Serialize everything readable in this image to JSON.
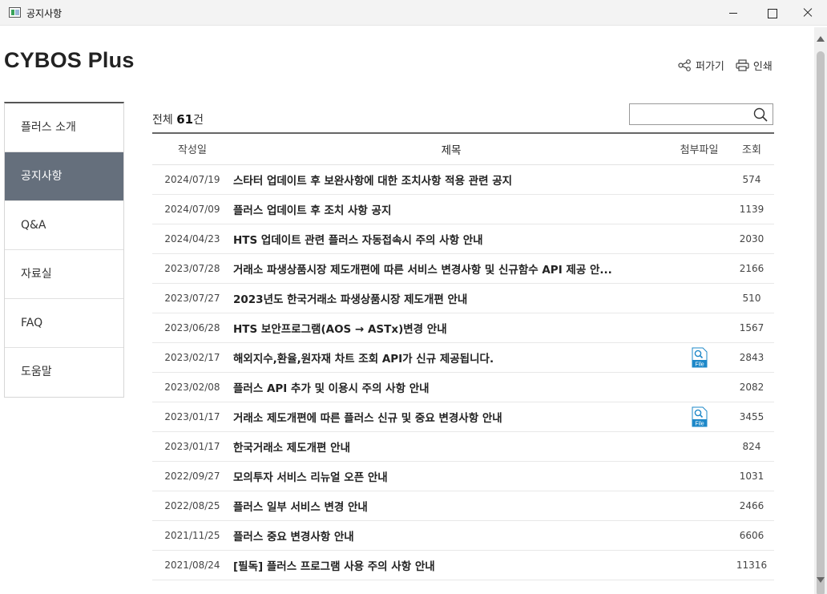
{
  "window": {
    "title": "공지사항"
  },
  "brand": "CYBOS Plus",
  "actions": {
    "share": "퍼가기",
    "print": "인쇄"
  },
  "sidebar": {
    "items": [
      {
        "label": "플러스 소개",
        "active": false
      },
      {
        "label": "공지사항",
        "active": true
      },
      {
        "label": "Q&A",
        "active": false
      },
      {
        "label": "자료실",
        "active": false
      },
      {
        "label": "FAQ",
        "active": false
      },
      {
        "label": "도움말",
        "active": false
      }
    ]
  },
  "board": {
    "total_prefix": "전체",
    "total_count": "61",
    "total_suffix": "건",
    "search": {
      "value": "",
      "placeholder": ""
    },
    "headers": {
      "date": "작성일",
      "title": "제목",
      "file": "첨부파일",
      "views": "조회"
    },
    "rows": [
      {
        "date": "2024/07/19",
        "title": "스타터 업데이트 후 보완사항에 대한 조치사항 적용 관련 공지",
        "file": false,
        "views": "574"
      },
      {
        "date": "2024/07/09",
        "title": "플러스 업데이트 후 조치 사항 공지",
        "file": false,
        "views": "1139"
      },
      {
        "date": "2024/04/23",
        "title": "HTS 업데이트 관련 플러스 자동접속시 주의 사항 안내",
        "file": false,
        "views": "2030"
      },
      {
        "date": "2023/07/28",
        "title": "거래소 파생상품시장 제도개편에 따른 서비스 변경사항 및 신규함수 API 제공 안...",
        "file": false,
        "views": "2166"
      },
      {
        "date": "2023/07/27",
        "title": "2023년도 한국거래소 파생상품시장 제도개편 안내",
        "file": false,
        "views": "510"
      },
      {
        "date": "2023/06/28",
        "title": "HTS 보안프로그램(AOS → ASTx)변경 안내",
        "file": false,
        "views": "1567"
      },
      {
        "date": "2023/02/17",
        "title": "해외지수,환율,원자재 차트 조회 API가 신규 제공됩니다.",
        "file": true,
        "views": "2843"
      },
      {
        "date": "2023/02/08",
        "title": "플러스 API 추가 및 이용시 주의 사항 안내",
        "file": false,
        "views": "2082"
      },
      {
        "date": "2023/01/17",
        "title": "거래소 제도개편에 따른 플러스 신규 및 중요 변경사항 안내",
        "file": true,
        "views": "3455"
      },
      {
        "date": "2023/01/17",
        "title": "한국거래소 제도개편 안내",
        "file": false,
        "views": "824"
      },
      {
        "date": "2022/09/27",
        "title": "모의투자 서비스 리뉴얼 오픈 안내",
        "file": false,
        "views": "1031"
      },
      {
        "date": "2022/08/25",
        "title": "플러스 일부 서비스 변경 안내",
        "file": false,
        "views": "2466"
      },
      {
        "date": "2021/11/25",
        "title": "플러스 중요 변경사항 안내",
        "file": false,
        "views": "6606"
      },
      {
        "date": "2021/08/24",
        "title": "[필독] 플러스 프로그램 사용 주의 사항 안내",
        "file": false,
        "views": "11316"
      }
    ],
    "file_icon_label": "File"
  },
  "colors": {
    "sidebar_active": "#656f7c",
    "file_icon": "#1e88c8"
  }
}
